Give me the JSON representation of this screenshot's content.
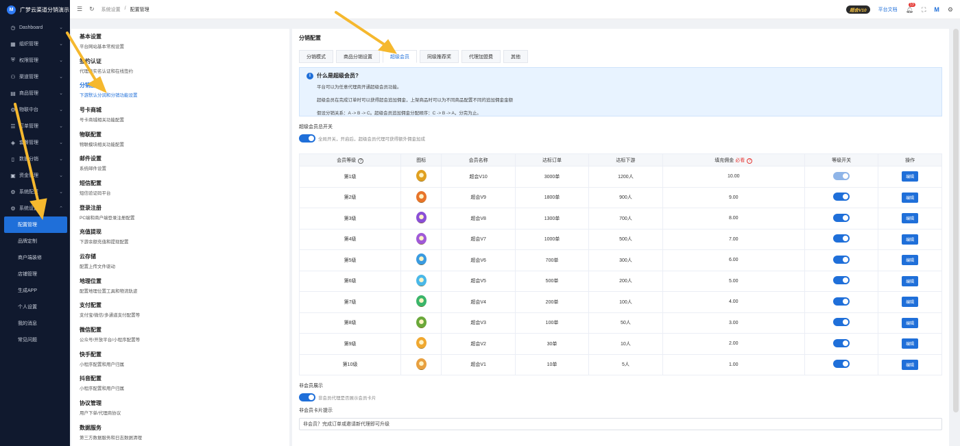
{
  "brand": {
    "name": "广梦云渠道分销演示",
    "logo": "M"
  },
  "sidebar": {
    "items": [
      {
        "label": "Dashboard",
        "icon": "dashboard-icon",
        "glyph": "◷"
      },
      {
        "label": "组织管理",
        "icon": "org-icon",
        "glyph": "▦"
      },
      {
        "label": "权限管理",
        "icon": "shield-icon",
        "glyph": "⛨"
      },
      {
        "label": "渠道管理",
        "icon": "channel-icon",
        "glyph": "⚇"
      },
      {
        "label": "商品管理",
        "icon": "goods-icon",
        "glyph": "▤"
      },
      {
        "label": "物联中台",
        "icon": "iot-icon",
        "glyph": "⚙"
      },
      {
        "label": "订单管理",
        "icon": "order-icon",
        "glyph": "☰"
      },
      {
        "label": "套餐管理",
        "icon": "package-icon",
        "glyph": "◈"
      },
      {
        "label": "数据分销",
        "icon": "mobile-icon",
        "glyph": "▯"
      },
      {
        "label": "资金管理",
        "icon": "fund-icon",
        "glyph": "▣"
      },
      {
        "label": "系统配置",
        "icon": "system-icon",
        "glyph": "⚙"
      },
      {
        "label": "系统设置",
        "icon": "settings-icon",
        "glyph": "⚙"
      }
    ],
    "sub_items": [
      "配置管理",
      "品牌定制",
      "商户端装修",
      "店铺管理",
      "生成APP",
      "个人设置",
      "我的消息",
      "常见问题"
    ]
  },
  "header": {
    "breadcrumb": [
      "系统设置",
      "配置管理"
    ],
    "vip_badge": "超会V10",
    "doc_link": "平台文档",
    "notification_count": "13"
  },
  "settings_menu": [
    {
      "title": "基本设置",
      "desc": "平台网站基本常规设置"
    },
    {
      "title": "签约认证",
      "desc": "代理商实名认证和在线签约"
    },
    {
      "title": "分销配置",
      "desc": "下游默认分润和分销功能设置"
    },
    {
      "title": "号卡商城",
      "desc": "号卡商城相关功能配置"
    },
    {
      "title": "物联配置",
      "desc": "物联模块相关功能配置"
    },
    {
      "title": "邮件设置",
      "desc": "系统邮件设置"
    },
    {
      "title": "短信配置",
      "desc": "短信验证码平台"
    },
    {
      "title": "登录注册",
      "desc": "PC端和商户端登录注册配置"
    },
    {
      "title": "充值提现",
      "desc": "下游余额充值和提现配置"
    },
    {
      "title": "云存储",
      "desc": "配置上传文件驱动"
    },
    {
      "title": "地理位置",
      "desc": "配置地理位置工具和物流轨迹"
    },
    {
      "title": "支付配置",
      "desc": "支付宝/微信/多通道支付配置等"
    },
    {
      "title": "微信配置",
      "desc": "公众号/开放平台/小程序配置等"
    },
    {
      "title": "快手配置",
      "desc": "小程序配置和用户归属"
    },
    {
      "title": "抖音配置",
      "desc": "小程序配置和用户归属"
    },
    {
      "title": "协议管理",
      "desc": "用户下单/代理商协议"
    },
    {
      "title": "数据服务",
      "desc": "第三方数据服务和日志数据清理"
    }
  ],
  "main": {
    "title": "分销配置",
    "tabs": [
      "分销模式",
      "商品分销设置",
      "超级会员",
      "同级推荐奖",
      "代理加盟费",
      "其他"
    ],
    "info": {
      "heading": "什么是超级会员?",
      "lines": [
        "平台可以为任意代理商开通超级会员功能。",
        "超级会员在完成订单时可以获得超会追加佣金，上架商品时可以为不同商品配置不同的追加佣金金额",
        "假设分销关系：A -> B -> C。超级会员追加佣金分配顺序：C -> B -> A，分完为止。"
      ]
    },
    "switch_label": "超级会员总开关",
    "switch_hint": "全局开关，开启后，超级会员代理可获得额外佣金加成",
    "table": {
      "headers": [
        "会员等级",
        "图标",
        "会员名称",
        "达标订单",
        "达标下游",
        "填充佣金",
        "等级开关",
        "操作"
      ],
      "required_tag": "必看",
      "edit_label": "编辑",
      "rows": [
        {
          "level": "第1级",
          "name": "超会V10",
          "orders": "3000单",
          "downstream": "1200人",
          "commission": "10.00",
          "medal": "#e0a020"
        },
        {
          "level": "第2级",
          "name": "超会V9",
          "orders": "1800单",
          "downstream": "900人",
          "commission": "9.00",
          "medal": "#e8742a"
        },
        {
          "level": "第3级",
          "name": "超会V8",
          "orders": "1300单",
          "downstream": "700人",
          "commission": "8.00",
          "medal": "#8a4fd6"
        },
        {
          "level": "第4级",
          "name": "超会V7",
          "orders": "1000单",
          "downstream": "500人",
          "commission": "7.00",
          "medal": "#a05ad8"
        },
        {
          "level": "第5级",
          "name": "超会V6",
          "orders": "700单",
          "downstream": "300人",
          "commission": "6.00",
          "medal": "#3a9be0"
        },
        {
          "level": "第6级",
          "name": "超会V5",
          "orders": "500单",
          "downstream": "200人",
          "commission": "5.00",
          "medal": "#4ab8e8"
        },
        {
          "level": "第7级",
          "name": "超会V4",
          "orders": "200单",
          "downstream": "100人",
          "commission": "4.00",
          "medal": "#3bb56a"
        },
        {
          "level": "第8级",
          "name": "超会V3",
          "orders": "100单",
          "downstream": "50人",
          "commission": "3.00",
          "medal": "#6aa83a"
        },
        {
          "level": "第9级",
          "name": "超会V2",
          "orders": "30单",
          "downstream": "10人",
          "commission": "2.00",
          "medal": "#f0a830"
        },
        {
          "level": "第10级",
          "name": "超会V1",
          "orders": "10单",
          "downstream": "5人",
          "commission": "1.00",
          "medal": "#e8a040"
        }
      ]
    },
    "non_member_label": "非会员展示",
    "non_member_hint": "非会员代理是否展示会员卡片",
    "card_hint_label": "非会员卡片提示",
    "card_hint_value": "非会员？完成订单或邀请新代理即可升级"
  },
  "colors": {
    "accent": "#1f6fd9",
    "sidebar_bg": "#10192e",
    "arrow": "#f5b82e"
  }
}
